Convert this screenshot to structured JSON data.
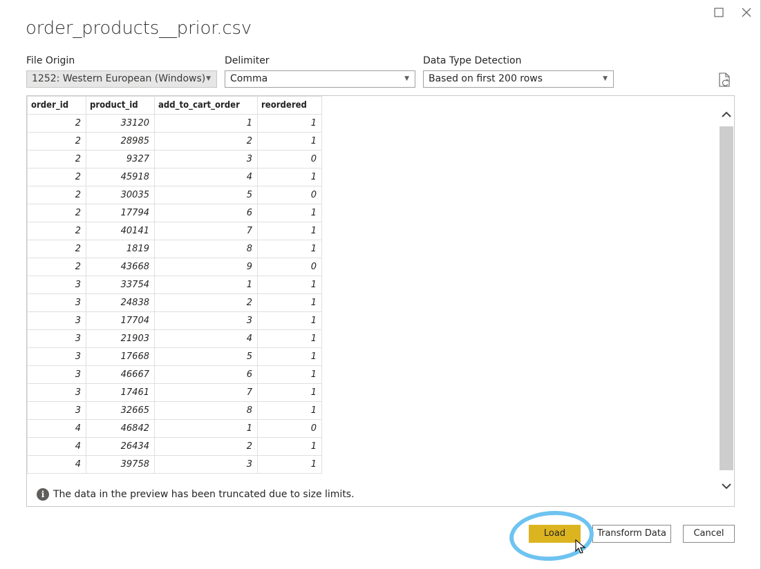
{
  "window": {
    "title": "order_products__prior.csv",
    "maximize_icon": "maximize-icon",
    "close_icon": "close-icon"
  },
  "fields": {
    "file_origin": {
      "label": "File Origin",
      "value": "1252: Western European (Windows)"
    },
    "delimiter": {
      "label": "Delimiter",
      "value": "Comma"
    },
    "type_detection": {
      "label": "Data Type Detection",
      "value": "Based on first 200 rows"
    }
  },
  "table": {
    "columns": [
      "order_id",
      "product_id",
      "add_to_cart_order",
      "reordered"
    ],
    "rows": [
      [
        "2",
        "33120",
        "1",
        "1"
      ],
      [
        "2",
        "28985",
        "2",
        "1"
      ],
      [
        "2",
        "9327",
        "3",
        "0"
      ],
      [
        "2",
        "45918",
        "4",
        "1"
      ],
      [
        "2",
        "30035",
        "5",
        "0"
      ],
      [
        "2",
        "17794",
        "6",
        "1"
      ],
      [
        "2",
        "40141",
        "7",
        "1"
      ],
      [
        "2",
        "1819",
        "8",
        "1"
      ],
      [
        "2",
        "43668",
        "9",
        "0"
      ],
      [
        "3",
        "33754",
        "1",
        "1"
      ],
      [
        "3",
        "24838",
        "2",
        "1"
      ],
      [
        "3",
        "17704",
        "3",
        "1"
      ],
      [
        "3",
        "21903",
        "4",
        "1"
      ],
      [
        "3",
        "17668",
        "5",
        "1"
      ],
      [
        "3",
        "46667",
        "6",
        "1"
      ],
      [
        "3",
        "17461",
        "7",
        "1"
      ],
      [
        "3",
        "32665",
        "8",
        "1"
      ],
      [
        "4",
        "46842",
        "1",
        "0"
      ],
      [
        "4",
        "26434",
        "2",
        "1"
      ],
      [
        "4",
        "39758",
        "3",
        "1"
      ]
    ]
  },
  "info": {
    "icon": "info-icon",
    "text": "The data in the preview has been truncated due to size limits."
  },
  "buttons": {
    "load": "Load",
    "transform": "Transform Data",
    "cancel": "Cancel"
  },
  "colors": {
    "load_button": "#dcb420",
    "highlight_circle": "#6ec3f0"
  }
}
